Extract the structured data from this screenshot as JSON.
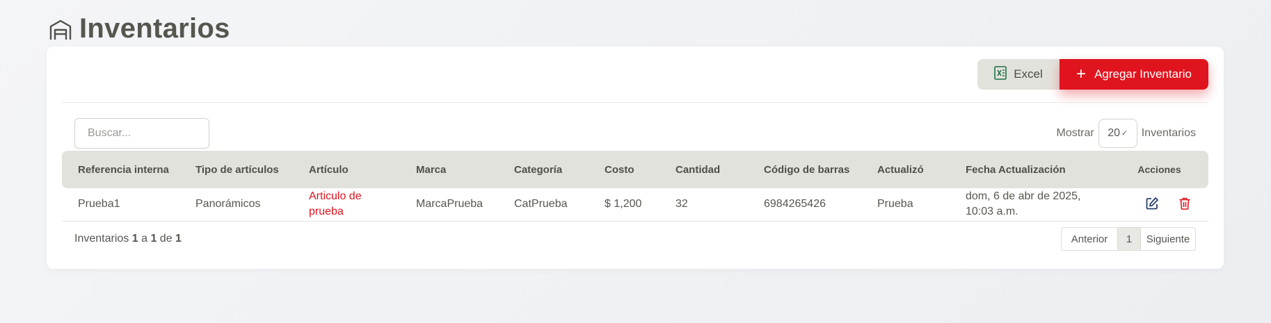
{
  "page": {
    "title": "Inventarios",
    "icon": "warehouse-icon"
  },
  "toolbar": {
    "excel_label": "Excel",
    "add_label": "Agregar Inventario"
  },
  "search": {
    "placeholder": "Buscar..."
  },
  "show": {
    "prefix": "Mostrar",
    "value": "20",
    "suffix": "Inventarios"
  },
  "table": {
    "headers": [
      "Referencia interna",
      "Tipo de artículos",
      "Artículo",
      "Marca",
      "Categoría",
      "Costo",
      "Cantidad",
      "Código de barras",
      "Actualizó",
      "Fecha Actualización",
      "Acciones"
    ],
    "rows": [
      {
        "referencia": "Prueba1",
        "tipo": "Panorámicos",
        "articulo": "Articulo de prueba",
        "marca": "MarcaPrueba",
        "categoria": "CatPrueba",
        "costo": "$ 1,200",
        "cantidad": "32",
        "codigo": "6984265426",
        "actualizo": "Prueba",
        "fecha": "dom, 6 de abr de 2025, 10:03 a.m."
      }
    ]
  },
  "footer": {
    "label": "Inventarios",
    "from": "1",
    "a": "a",
    "to": "1",
    "de": "de",
    "total": "1",
    "pager": {
      "prev": "Anterior",
      "current": "1",
      "next": "Siguiente"
    }
  },
  "colors": {
    "accent": "#e0141e",
    "excel": "#1d6f42",
    "edit": "#2c3e6b"
  }
}
